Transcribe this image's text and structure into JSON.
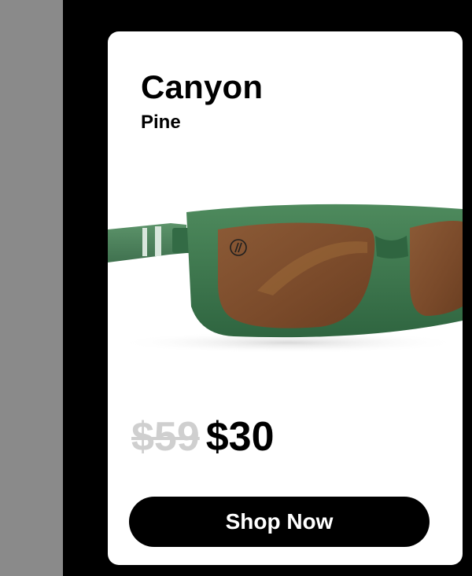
{
  "product": {
    "name": "Canyon",
    "variant": "Pine",
    "image_icon": "sunglasses-product-image",
    "original_price": "$59",
    "sale_price": "$30"
  },
  "actions": {
    "shop_label": "Shop Now"
  },
  "colors": {
    "page_background": "#000000",
    "side_panel": "#8a8a8a",
    "card_background": "#ffffff",
    "frame_green": "#3f7a4f",
    "lens_brown": "#7a4a2a",
    "old_price": "#cfcfcf",
    "button_background": "#000000",
    "button_text": "#ffffff"
  }
}
